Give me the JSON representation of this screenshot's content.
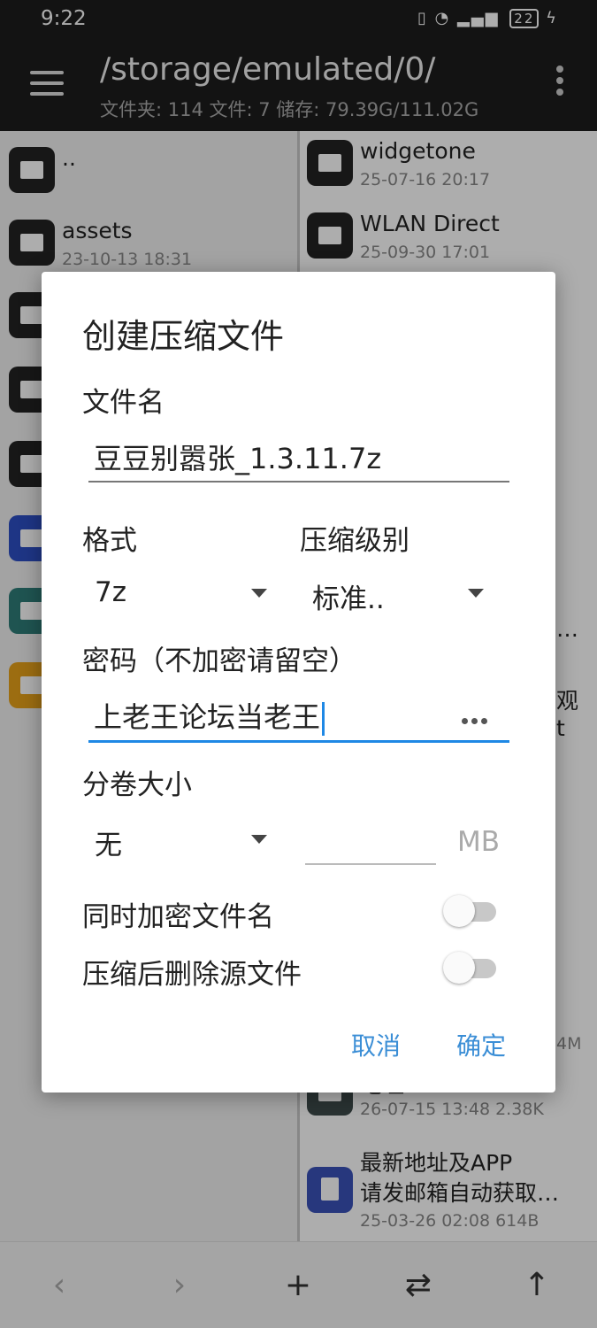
{
  "status_bar": {
    "time": "9:22",
    "battery": "22"
  },
  "app_bar": {
    "path": "/storage/emulated/0/",
    "stats": "文件夹: 114  文件: 7  储存: 79.39G/111.02G"
  },
  "left_pane": {
    "items": [
      {
        "name": "..",
        "meta": ""
      },
      {
        "name": "assets",
        "meta": "23-10-13 18:31"
      }
    ]
  },
  "right_pane": {
    "items": [
      {
        "name": "widgetone",
        "meta": "25-07-16 20:17"
      },
      {
        "name": "WLAN Direct",
        "meta": "25-09-30 17:01"
      }
    ],
    "partial": [
      "…",
      "观",
      "t",
      "4M"
    ],
    "lower_items": [
      {
        "name": "地址",
        "meta": "26-07-15 13:48  2.38K"
      },
      {
        "name": "最新地址及APP",
        "name2": "请发邮箱自动获取…",
        "meta": "25-03-26 02:08  614B"
      }
    ]
  },
  "dialog": {
    "title": "创建压缩文件",
    "filename_label": "文件名",
    "filename_value": "豆豆别嚣张_1.3.11.7z",
    "format_label": "格式",
    "format_value": "7z",
    "level_label": "压缩级别",
    "level_value": "标准..",
    "password_label": "密码（不加密请留空）",
    "password_value": "上老王论坛当老王",
    "split_label": "分卷大小",
    "split_value": "无",
    "split_unit": "MB",
    "encrypt_names_label": "同时加密文件名",
    "delete_source_label": "压缩后删除源文件",
    "cancel": "取消",
    "confirm": "确定"
  },
  "bottom_bar": {
    "back": "‹",
    "forward": "›",
    "add": "+",
    "swap": "⇄",
    "up": "↑"
  }
}
